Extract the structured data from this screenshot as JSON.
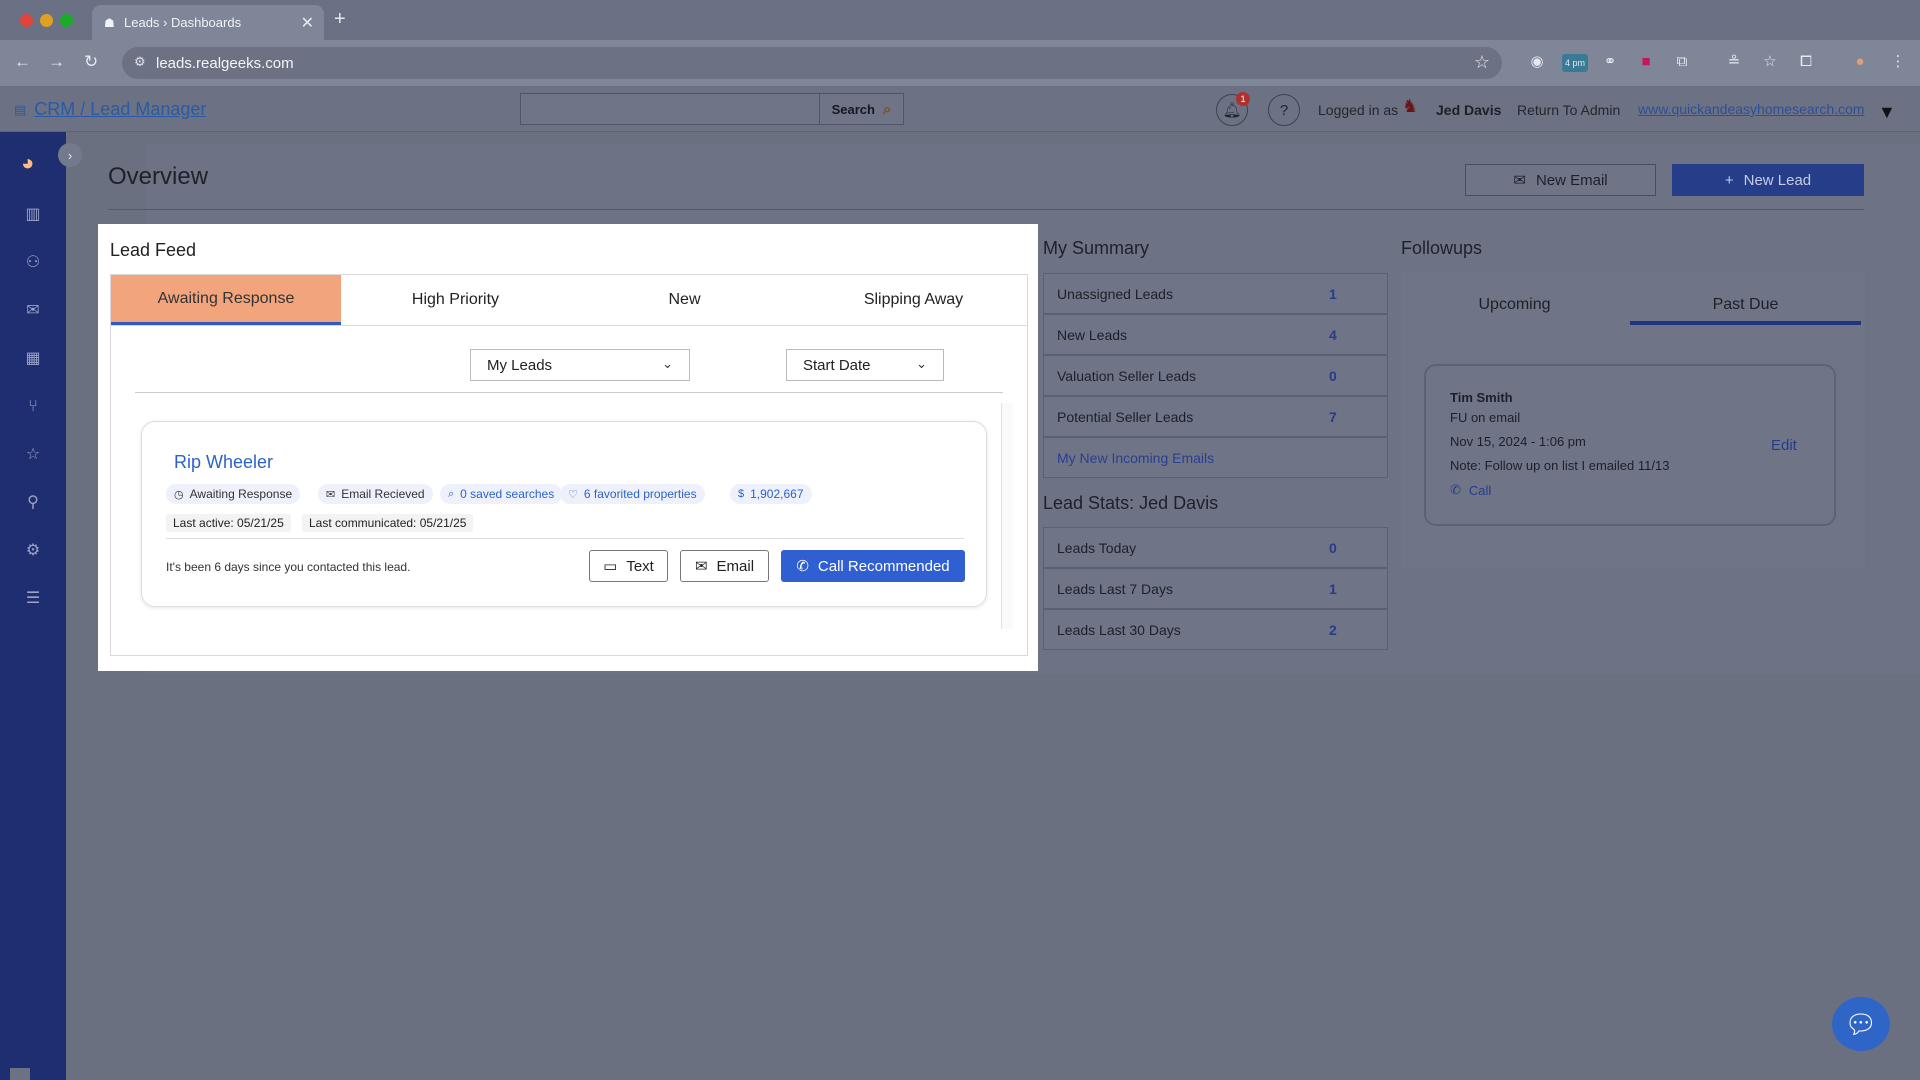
{
  "browser": {
    "tab_title": "Leads › Dashboards",
    "tab_favicon": "☗",
    "tab_close": "✕",
    "new_tab": "+",
    "url": "leads.realgeeks.com",
    "ext_badge": "4 pm"
  },
  "header": {
    "title": "CRM / Lead Manager",
    "search_value": "",
    "search_label": "Search",
    "bell_count": "1",
    "logged_in_label": "Logged in as",
    "user_name": "Jed Davis",
    "return_admin": "Return To Admin",
    "site_link": "www.quickandeasyhomesearch.com"
  },
  "main": {
    "page_title": "Overview",
    "new_email_label": "New Email",
    "new_lead_label": "New Lead"
  },
  "lead_feed": {
    "title": "Lead Feed",
    "tabs": [
      {
        "label": "Awaiting Response",
        "active": true
      },
      {
        "label": "High Priority"
      },
      {
        "label": "New"
      },
      {
        "label": "Slipping Away"
      }
    ],
    "filter_owner": "My Leads",
    "filter_sort": "Start Date",
    "lead": {
      "name": "Rip Wheeler",
      "chips": {
        "status": "Awaiting Response",
        "email": "Email Recieved",
        "searches": "0 saved searches",
        "favorites": "6 favorited properties",
        "price": "1,902,667"
      },
      "last_active": "Last active: 05/21/25",
      "last_communicated": "Last communicated: 05/21/25",
      "note": "It's been 6 days since you contacted this lead.",
      "buttons": {
        "text": "Text",
        "email": "Email",
        "call": "Call Recommended"
      }
    }
  },
  "summary": {
    "title": "My Summary",
    "rows": [
      {
        "label": "Unassigned Leads",
        "value": "1"
      },
      {
        "label": "New Leads",
        "value": "4"
      },
      {
        "label": "Valuation Seller Leads",
        "value": "0"
      },
      {
        "label": "Potential Seller Leads",
        "value": "7"
      },
      {
        "label": "My New Incoming Emails"
      }
    ]
  },
  "lead_stats": {
    "title": "Lead Stats: Jed Davis",
    "rows": [
      {
        "label": "Leads Today",
        "value": "0"
      },
      {
        "label": "Leads Last 7 Days",
        "value": "1"
      },
      {
        "label": "Leads Last 30 Days",
        "value": "2"
      }
    ]
  },
  "followups": {
    "title": "Followups",
    "tabs": [
      {
        "label": "Upcoming"
      },
      {
        "label": "Past Due",
        "active": true
      }
    ],
    "card": {
      "name": "Tim Smith",
      "subject": "FU on email",
      "datetime": "Nov 15, 2024 - 1:06 pm",
      "note": "Note: Follow up on list I emailed 11/13",
      "call_label": "Call",
      "edit_label": "Edit"
    }
  },
  "colors": {
    "sidebar": "#1e2e70",
    "active_tab": "#f2a47c",
    "primary": "#2f5fd0",
    "link": "#2b63c9"
  }
}
